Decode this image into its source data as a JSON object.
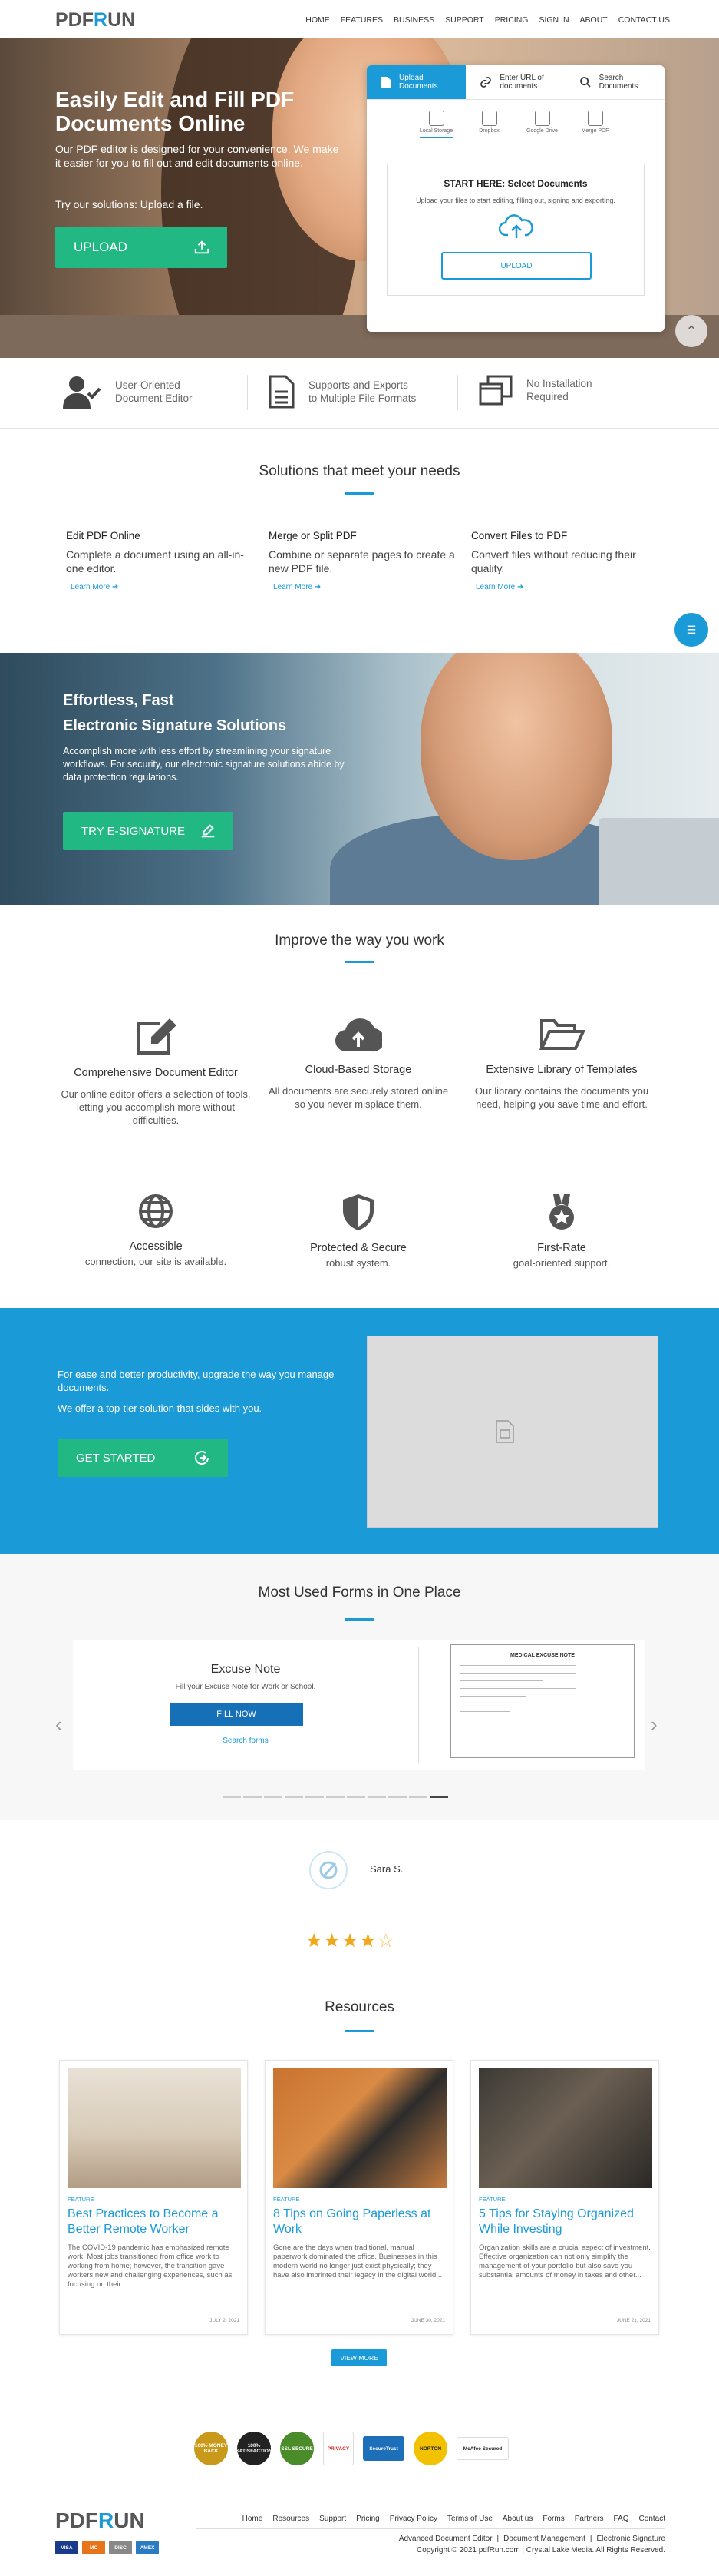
{
  "header": {
    "logo": {
      "left": "PDF",
      "mid": "R",
      "right": "UN"
    },
    "nav": [
      "HOME",
      "FEATURES",
      "BUSINESS",
      "SUPPORT",
      "PRICING",
      "SIGN IN",
      "ABOUT",
      "CONTACT US"
    ]
  },
  "hero": {
    "title": "Easily Edit and Fill PDF Documents Online",
    "desc": "Our PDF editor is designed for your convenience. We make it easier for you to fill out and edit documents online.",
    "try_text": "Try our solutions: Upload a file.",
    "upload_button": "UPLOAD"
  },
  "upload_card": {
    "tabs": [
      {
        "label": "Upload Documents"
      },
      {
        "label": "Enter URL of documents"
      },
      {
        "label": "Search Documents"
      }
    ],
    "sources": [
      "Local Storage",
      "Dropbox",
      "Google Drive",
      "Merge PDF"
    ],
    "start_title": "START HERE: Select Documents",
    "start_desc": "Upload your files to start editing, filling out, signing and exporting.",
    "upload_button": "UPLOAD"
  },
  "features_strip": [
    {
      "l1": "User-Oriented",
      "l2": "Document Editor"
    },
    {
      "l1": "Supports and Exports",
      "l2": "to Multiple File Formats"
    },
    {
      "l1": "No Installation",
      "l2": "Required"
    }
  ],
  "solutions": {
    "title": "Solutions that meet your needs",
    "items": [
      {
        "title": "Edit PDF Online",
        "desc": "Complete a document using an all-in-one editor.",
        "link": "Learn More"
      },
      {
        "title": "Merge or Split PDF",
        "desc": "Combine or separate pages to create a new PDF file.",
        "link": "Learn More"
      },
      {
        "title": "Convert Files to PDF",
        "desc": "Convert files without reducing their quality.",
        "link": "Learn More"
      }
    ]
  },
  "esign": {
    "title_l1": "Effortless, Fast",
    "title_l2": "Electronic Signature Solutions",
    "desc": "Accomplish more with less effort by streamlining your signature workflows. For security, our electronic signature solutions abide by data protection regulations.",
    "button": "TRY E-SIGNATURE"
  },
  "improve": {
    "title": "Improve the way you work",
    "items": [
      {
        "title": "Comprehensive Document Editor",
        "desc": "Our online editor offers a selection of tools, letting you accomplish more without difficulties.",
        "icon": "edit-icon"
      },
      {
        "title": "Cloud-Based Storage",
        "desc": "All documents are securely stored online so you never misplace them.",
        "icon": "cloud-upload-icon"
      },
      {
        "title": "Extensive Library of Templates",
        "desc": "Our library contains the documents you need, helping you save time and effort.",
        "icon": "folder-open-icon"
      },
      {
        "title": "Accessible",
        "desc": "connection, our site is available.",
        "icon": "globe-icon"
      },
      {
        "title": "Protected & Secure",
        "desc": "robust system.",
        "icon": "shield-icon"
      },
      {
        "title": "First-Rate",
        "desc": "goal-oriented support.",
        "icon": "medal-icon"
      }
    ]
  },
  "productivity": {
    "p1": "For ease and better productivity, upgrade the way you manage documents.",
    "p2": "We offer a top-tier solution that sides with you.",
    "button": "GET STARTED"
  },
  "forms": {
    "title": "Most Used Forms in One Place",
    "form_name": "Excuse Note",
    "form_desc": "Fill your Excuse Note for Work or School.",
    "fill_button": "FILL NOW",
    "search_link": "Search forms",
    "doc_title": "MEDICAL EXCUSE NOTE"
  },
  "testimonial": {
    "name": "Sara S.",
    "rating": 4.5
  },
  "resources": {
    "title": "Resources",
    "posts": [
      {
        "tag": "FEATURE",
        "title": "Best Practices to Become a Better Remote Worker",
        "excerpt": "The COVID-19 pandemic has emphasized remote work. Most jobs transitioned from office work to working from home; however, the transition gave workers new and challenging experiences, such as focusing on their...",
        "date": "JULY 2, 2021"
      },
      {
        "tag": "FEATURE",
        "title": "8 Tips on Going Paperless at Work",
        "excerpt": "Gone are the days when traditional, manual paperwork dominated the office. Businesses in this modern world no longer just exist physically; they have also imprinted their legacy in the digital world...",
        "date": "JUNE 30, 2021"
      },
      {
        "tag": "FEATURE",
        "title": "5 Tips for Staying Organized While Investing",
        "excerpt": "Organization skills are a crucial aspect of investment. Effective organization can not only simplify the management of your portfolio but also save you substantial amounts of money in taxes and other...",
        "date": "JUNE 21, 2021"
      }
    ],
    "view_more": "VIEW MORE"
  },
  "badges": [
    "100% MONEY BACK",
    "100% SATISFACTION",
    "SSL SECURE",
    "PRIVACY",
    "SecureTrust",
    "NORTON",
    "McAfee Secured"
  ],
  "footer": {
    "links": [
      "Home",
      "Resources",
      "Support",
      "Pricing",
      "Privacy Policy",
      "Terms of Use",
      "About us",
      "Forms",
      "Partners",
      "FAQ",
      "Contact"
    ],
    "links2": [
      "Advanced Document Editor",
      "|",
      "Document Management",
      "|",
      "Electronic Signature"
    ],
    "copyright": "Copyright © 2021 pdfRun.com   |   Crystal Lake Media. All Rights Reserved.",
    "payments": [
      "VISA",
      "MC",
      "DISC",
      "AMEX"
    ]
  },
  "colors": {
    "accent": "#1a9ad6",
    "green": "#22b884",
    "star": "#f0a81c"
  }
}
